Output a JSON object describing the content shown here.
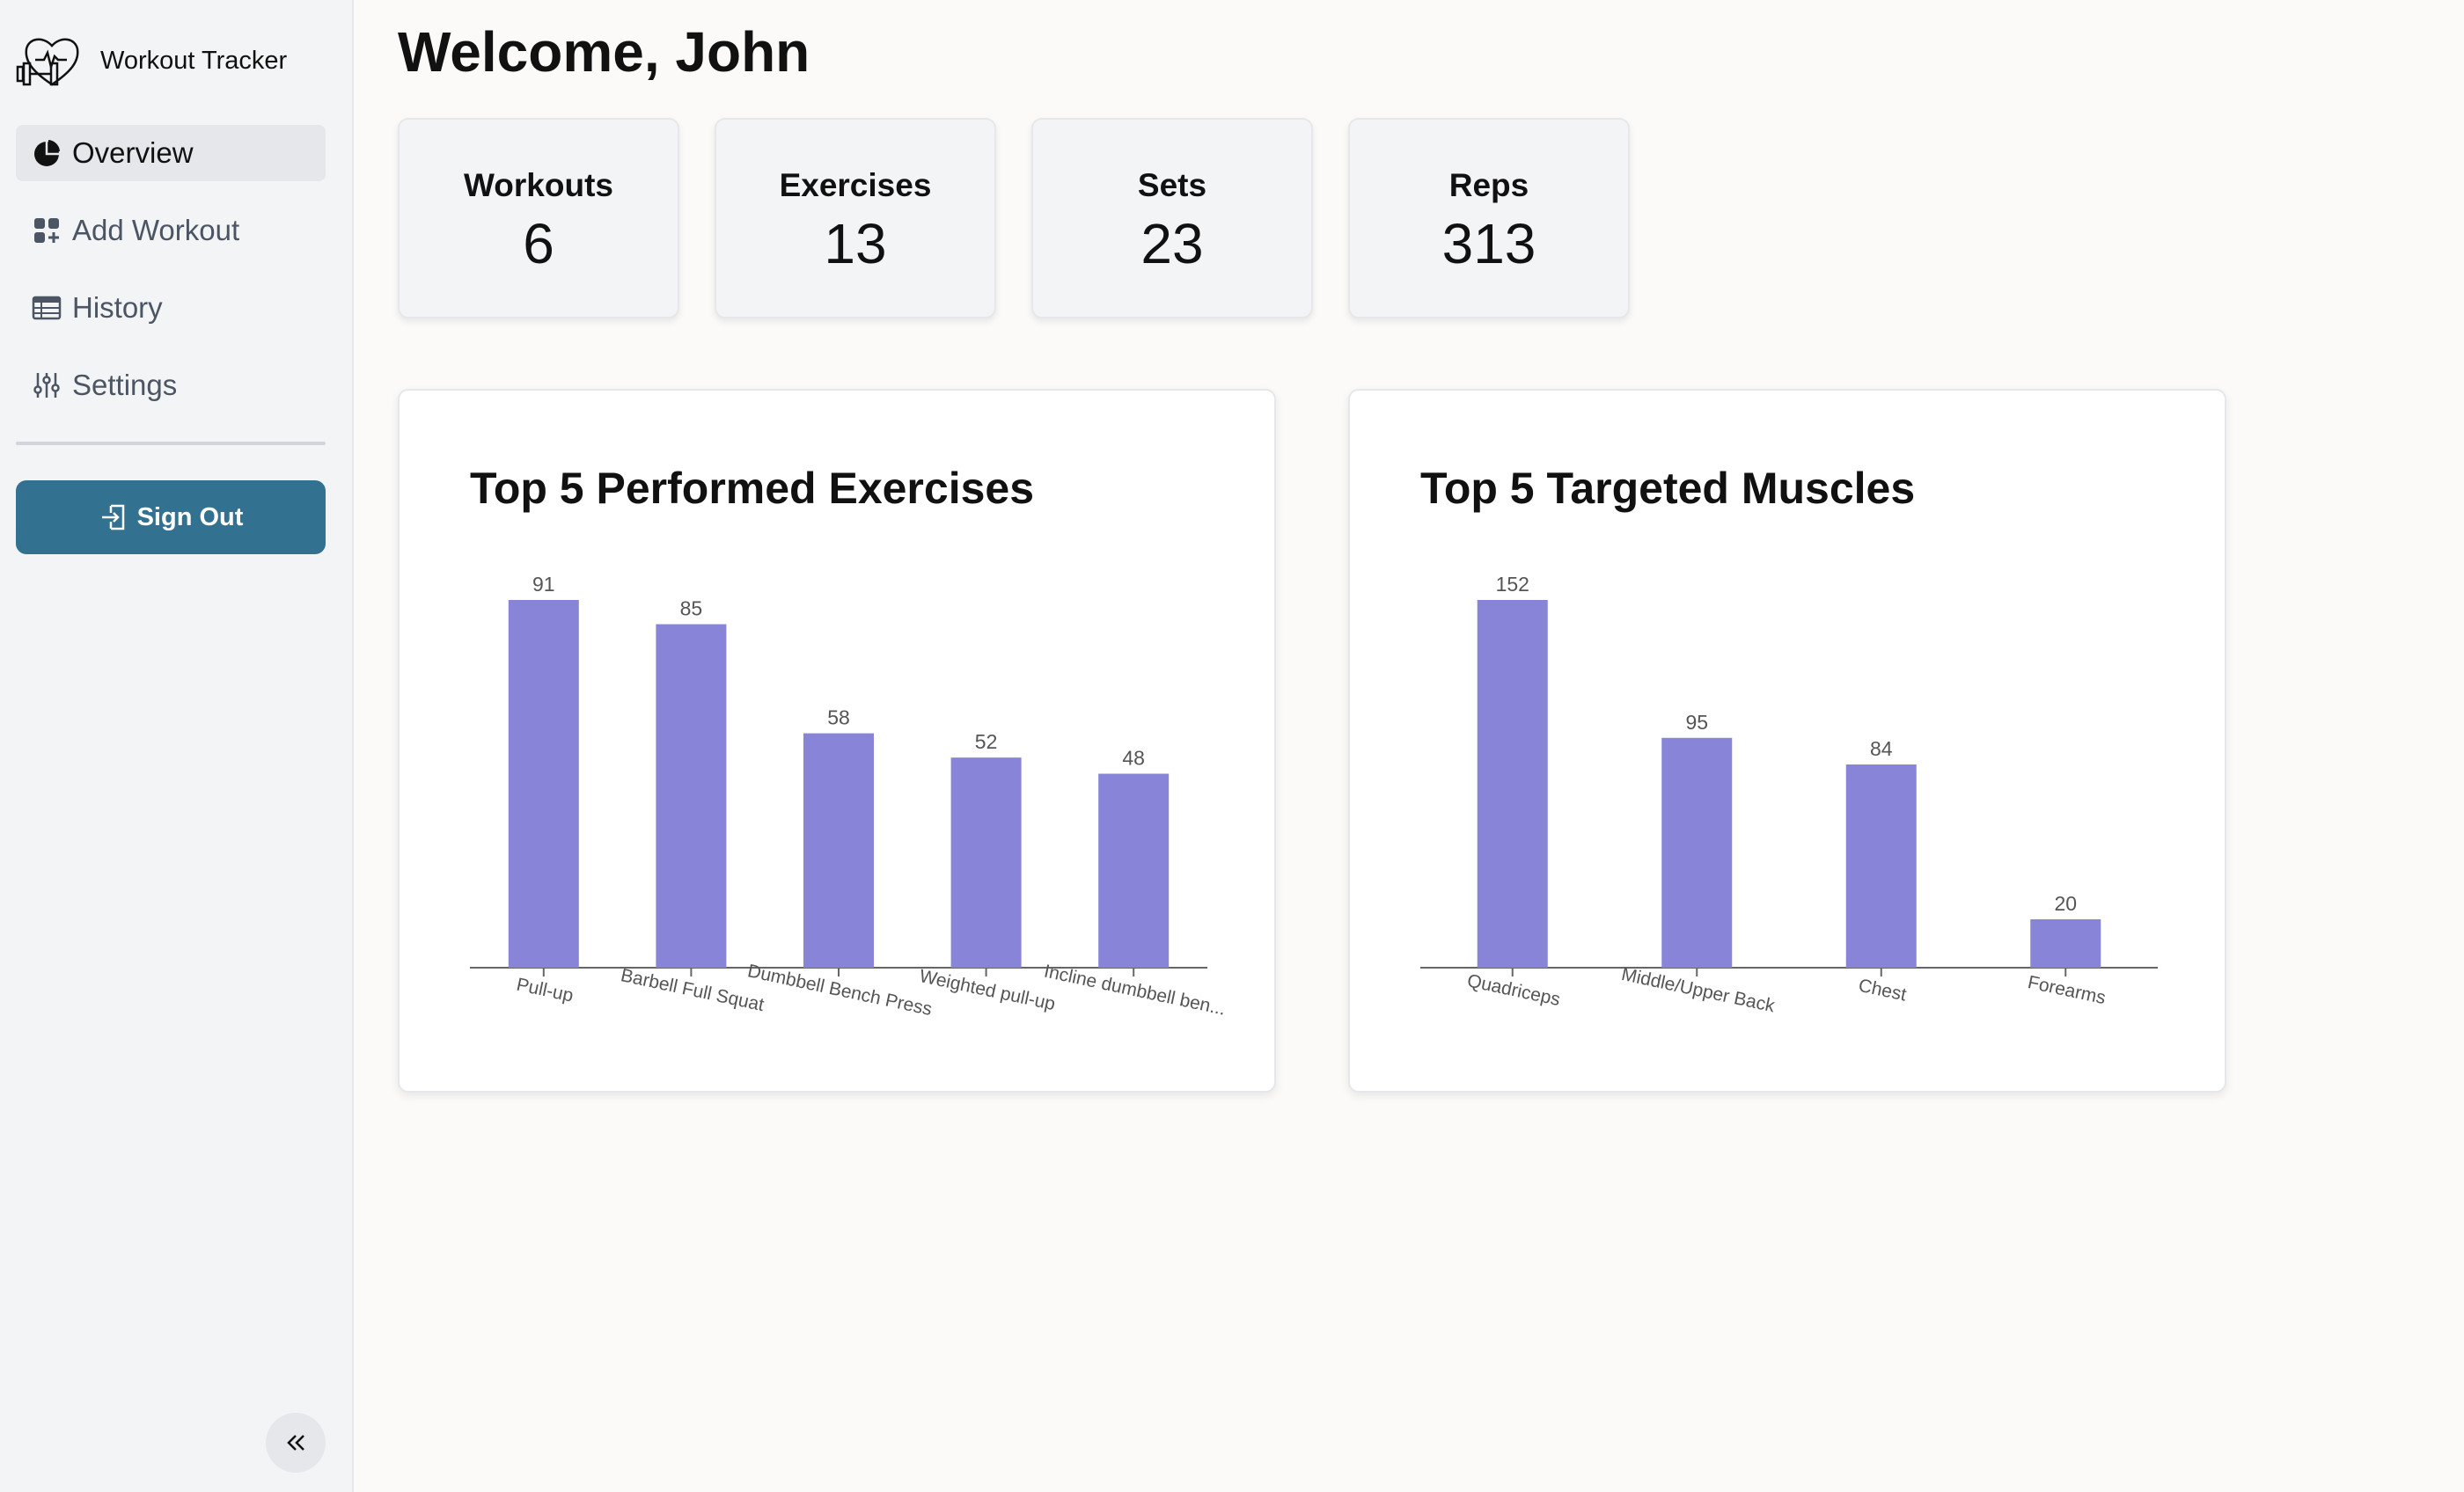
{
  "sidebar": {
    "app_title": "Workout Tracker",
    "items": [
      {
        "label": "Overview",
        "icon": "pie-chart-icon",
        "active": true
      },
      {
        "label": "Add Workout",
        "icon": "grid-plus-icon",
        "active": false
      },
      {
        "label": "History",
        "icon": "table-icon",
        "active": false
      },
      {
        "label": "Settings",
        "icon": "sliders-icon",
        "active": false
      }
    ],
    "sign_out_label": "Sign Out",
    "accent_color": "#32718f"
  },
  "main": {
    "welcome": "Welcome, John",
    "stats": [
      {
        "label": "Workouts",
        "value": "6"
      },
      {
        "label": "Exercises",
        "value": "13"
      },
      {
        "label": "Sets",
        "value": "23"
      },
      {
        "label": "Reps",
        "value": "313"
      }
    ]
  },
  "chart_data": [
    {
      "type": "bar",
      "title": "Top 5 Performed Exercises",
      "categories": [
        "Pull-up",
        "Barbell Full Squat",
        "Dumbbell Bench Press",
        "Weighted pull-up",
        "Incline dumbbell ben..."
      ],
      "values": [
        91,
        85,
        58,
        52,
        48
      ],
      "ylim": [
        0,
        91
      ],
      "grid": false,
      "bar_color": "#8884d8"
    },
    {
      "type": "bar",
      "title": "Top 5 Targeted Muscles",
      "categories": [
        "Quadriceps",
        "Middle/Upper Back",
        "Chest",
        "Forearms"
      ],
      "values": [
        152,
        95,
        84,
        20
      ],
      "ylim": [
        0,
        152
      ],
      "grid": false,
      "bar_color": "#8884d8"
    }
  ]
}
